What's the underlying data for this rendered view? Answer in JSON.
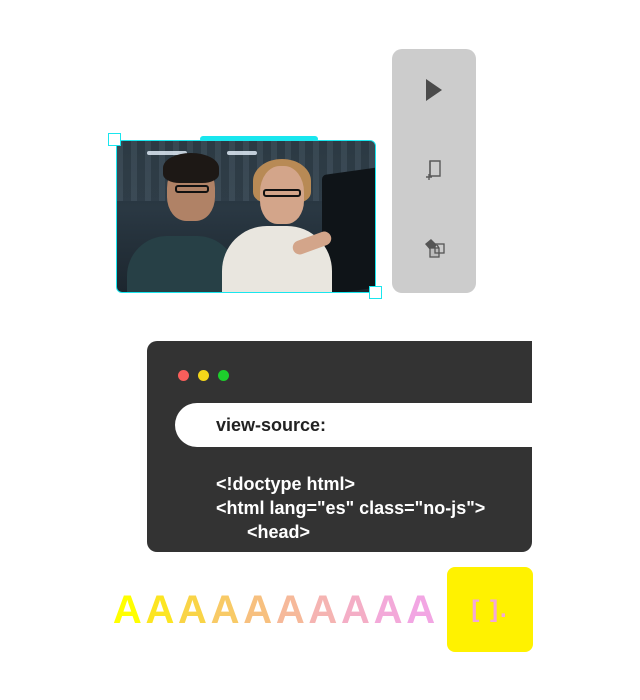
{
  "photo": {
    "alt_subject": "two-people-at-monitor"
  },
  "tools": [
    {
      "icon": "cursor-icon"
    },
    {
      "icon": "resize-page-icon"
    },
    {
      "icon": "paint-bucket-icon"
    }
  ],
  "code_window": {
    "traffic_lights": [
      "#fa5e5b",
      "#f4d61a",
      "#1dcf2c"
    ],
    "address": "view-source:",
    "lines": [
      "<!doctype html>",
      "<html lang=\"es\" class=\"no-js\">",
      "<head>"
    ]
  },
  "specimen": {
    "letters": [
      "A",
      "A",
      "A",
      "A",
      "A",
      "A",
      "A",
      "A",
      "A",
      "A"
    ],
    "colors": [
      "#ffff00",
      "#fce522",
      "#f9d447",
      "#f8ca66",
      "#f7c07f",
      "#f6b99a",
      "#f5b4b2",
      "#f4aec6",
      "#f3a9d9",
      "#f2a6e3"
    ]
  },
  "brand": {
    "mark": "[ ].",
    "background": "#fff200",
    "color": "#f3a8d8"
  },
  "accent": "#19e6ee"
}
